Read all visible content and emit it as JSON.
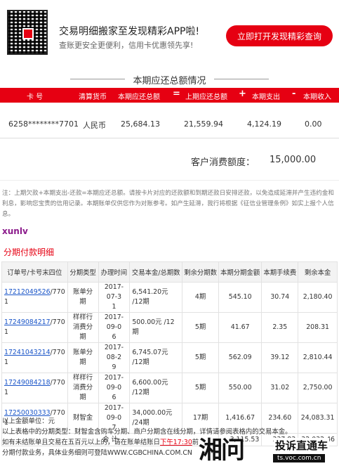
{
  "banner": {
    "title": "交易明细搬家至发现精彩APP啦!",
    "subtitle": "查账更安全更便利，信用卡优惠领先享!",
    "button": "立即打开发现精彩查询"
  },
  "summary": {
    "section_title": "本期应还总额情况",
    "headers": {
      "card_no": "卡 号",
      "currency": "清算货币",
      "due_total": "本期应还总额",
      "eq": "=",
      "last_due": "上期应还总额",
      "plus": "+",
      "expense": "本期支出",
      "minus": "-",
      "income": "本期收入"
    },
    "row": {
      "card_no": "6258********7701",
      "currency": "人民币",
      "due_total": "25,684.13",
      "last_due": "21,559.94",
      "expense": "4,124.19",
      "income": "0.00"
    },
    "credit_label": "客户消费额度：",
    "credit_value": "15,000.00"
  },
  "note": "注：上期欠款+本期支出-还款=本期应还总额。请按卡片对应的还款额和到期还款日安排还款，以免造成延滞并产生违约金和利息，影响您宝贵的信用记录。本期账单仅供您作为对账参考。如产生延滞，我行将根据《征信业管理条例》如实上报个人信息。",
  "watermark": "xunlv",
  "installments": {
    "title": "分期付款明细",
    "headers": [
      "订单号/卡号末四位",
      "分期类型",
      "办理时间",
      "交易本金/总期数",
      "剩余分期数",
      "本期分期金额",
      "本期手续费",
      "剩余本金"
    ],
    "rows": [
      {
        "order": "17212049526",
        "tail": "/770",
        "tail2": "1",
        "type": "账单分期",
        "date1": "2017-07-3",
        "date2": "1",
        "principal": "6,541.20元 /12期",
        "remain": "4期",
        "amount": "545.10",
        "fee": "30.74",
        "left": "2,180.40"
      },
      {
        "order": "17249084217",
        "tail": "/770",
        "tail2": "1",
        "type": "样样行消费分期",
        "date1": "2017-09-0",
        "date2": "6",
        "principal": "500.00元 /12期",
        "remain": "5期",
        "amount": "41.67",
        "fee": "2.35",
        "left": "208.31"
      },
      {
        "order": "17241043214",
        "tail": "/770",
        "tail2": "1",
        "type": "账单分期",
        "date1": "2017-08-2",
        "date2": "9",
        "principal": "6,745.07元 /12期",
        "remain": "5期",
        "amount": "562.09",
        "fee": "39.12",
        "left": "2,810.44"
      },
      {
        "order": "17249084218",
        "tail": "/770",
        "tail2": "1",
        "type": "样样行消费分期",
        "date1": "2017-09-0",
        "date2": "6",
        "principal": "6,600.00元 /12期",
        "remain": "5期",
        "amount": "550.00",
        "fee": "31.02",
        "left": "2,750.00"
      },
      {
        "order": "17250030333",
        "tail": "/770",
        "tail2": "1",
        "type": "财智金",
        "date1": "2017-09-0",
        "date2": "7",
        "principal": "34,000.00元 /24期",
        "remain": "17期",
        "amount": "1,416.67",
        "fee": "234.60",
        "left": "24,083.31"
      }
    ],
    "total_label": "合 计",
    "total_amount": "3,115.53",
    "total_fee": "337.83",
    "total_left": "32,032.46"
  },
  "footer": {
    "unit": "以上金额单位：元",
    "line2": "以上表格中的分期类型：财智金含购车分期、商户分期含在线分期，详情请参阅表格内的交易本金。",
    "line3a": "如有未结账单且交易在五百元以上的，请在账单结账日",
    "line3link": "下午17:30",
    "line3b": "前",
    "line4": "分期付款业务，具体业务细则可登陆WWW.CGBCHINA.COM.CN"
  },
  "logo": {
    "big": "湘问",
    "name": "投诉直通车",
    "url": "ts.voc.com.cn"
  }
}
